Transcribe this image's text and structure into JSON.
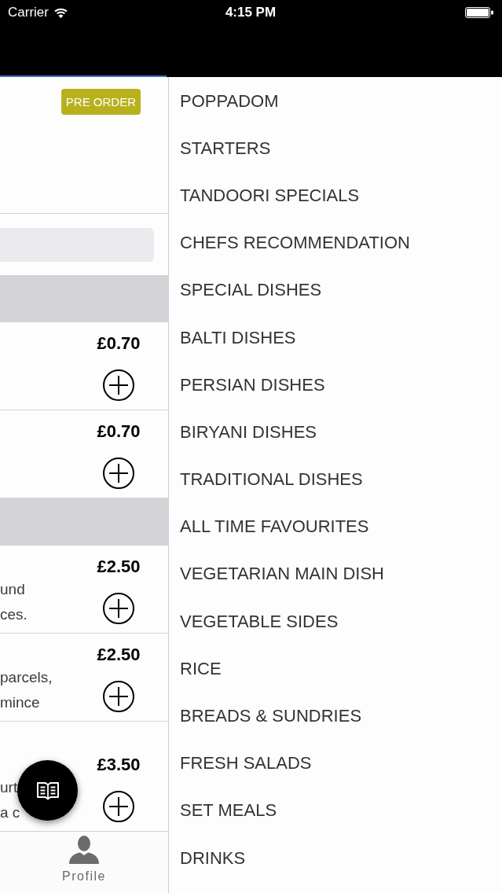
{
  "status_bar": {
    "carrier": "Carrier",
    "time": "4:15 PM"
  },
  "menu": {
    "badge": "PRE ORDER",
    "rows": [
      {
        "kind": "section"
      },
      {
        "kind": "item",
        "price": "£0.70"
      },
      {
        "kind": "item",
        "price": "£0.70"
      },
      {
        "kind": "section"
      },
      {
        "kind": "item",
        "price": "£2.50",
        "description": [
          "und",
          "ces."
        ]
      },
      {
        "kind": "item",
        "price": "£2.50",
        "description": [
          "parcels,",
          "mince"
        ]
      },
      {
        "kind": "item",
        "price": "£3.50",
        "description": [
          "urt",
          "a c"
        ]
      }
    ]
  },
  "tab_bar": {
    "items": [
      {
        "label": "Profile"
      }
    ]
  },
  "categories": [
    "POPPADOM",
    "STARTERS",
    "TANDOORI SPECIALS",
    "CHEFS RECOMMENDATION",
    "SPECIAL DISHES",
    "BALTI DISHES",
    "PERSIAN DISHES",
    "BIRYANI DISHES",
    "TRADITIONAL DISHES",
    "ALL TIME FAVOURITES",
    "VEGETARIAN MAIN DISH",
    "VEGETABLE SIDES",
    "RICE",
    "BREADS & SUNDRIES",
    "FRESH SALADS",
    "SET MEALS",
    "DRINKS"
  ]
}
